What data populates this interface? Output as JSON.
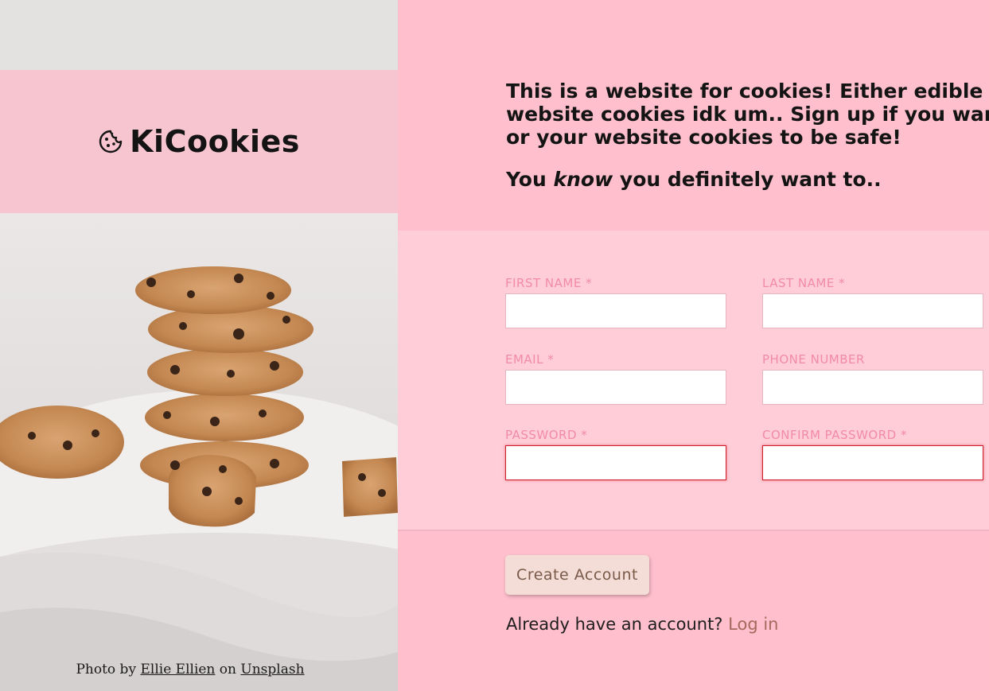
{
  "brand": {
    "name": "KiCookies",
    "icon": "cookie-icon"
  },
  "photo_credit": {
    "prefix": "Photo by",
    "author": "Ellie Ellien",
    "middle": "on",
    "site": "Unsplash"
  },
  "intro": {
    "line1": "This is a website for cookies! Either edible or th",
    "line2": "website cookies idk um.. Sign up if you want Yu",
    "line3": "or your website cookies to be safe!",
    "line4_before": "You",
    "line4_emphasis": "know",
    "line4_after": "you definitely want to.."
  },
  "form": {
    "first_name_label": "FIRST NAME *",
    "first_name_value": "",
    "last_name_label": "LAST NAME *",
    "last_name_value": "",
    "email_label": "EMAIL *",
    "email_value": "",
    "phone_label": "PHONE NUMBER",
    "phone_value": "",
    "password_label": "PASSWORD *",
    "password_value": "",
    "confirm_password_label": "CONFIRM PASSWORD *",
    "confirm_password_value": ""
  },
  "actions": {
    "create_account_label": "Create Account",
    "login_prompt": "Already have an account?",
    "login_link": "Log in"
  },
  "colors": {
    "right_background": "#ffbfcc",
    "form_background": "#ffcdd7",
    "logo_band": "#f6c5cf",
    "label_pink": "#f28ba6",
    "button_bg": "#f3ddd6",
    "button_text": "#7a5a49",
    "login_link": "#a56a5e",
    "invalid_border": "#d21f2e"
  }
}
